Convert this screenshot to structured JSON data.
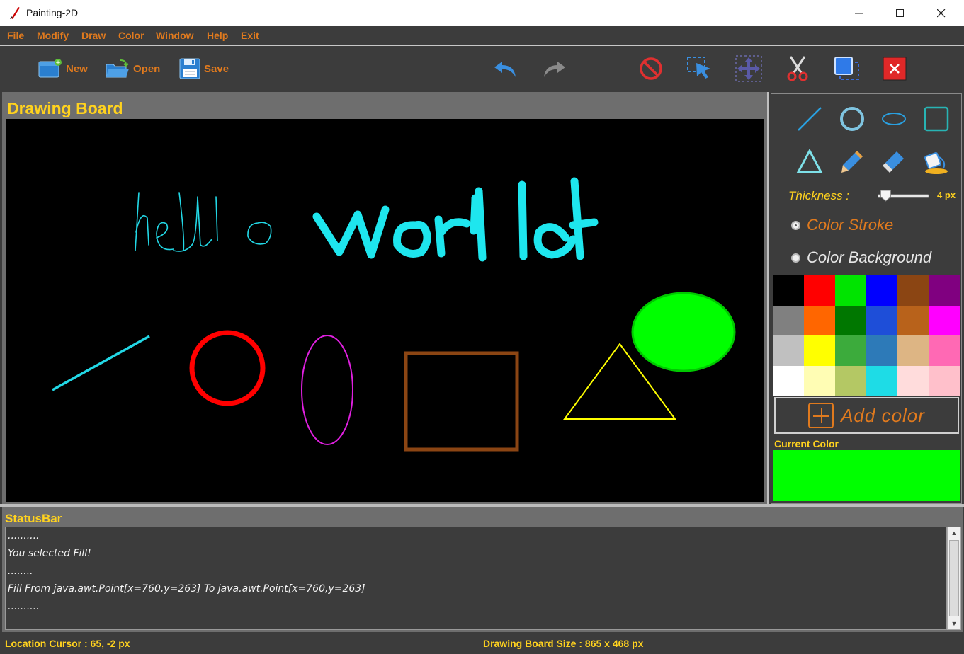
{
  "window": {
    "title": "Painting-2D",
    "minimize": "—",
    "maximize": "☐",
    "close": "✕"
  },
  "menu": [
    "File",
    "Modify",
    "Draw",
    "Color",
    "Window",
    "Help",
    "Exit"
  ],
  "toolbar": {
    "new_label": "New",
    "open_label": "Open",
    "save_label": "Save",
    "icons": [
      "new-file-icon",
      "open-folder-icon",
      "save-floppy-icon",
      "undo-icon",
      "redo-icon",
      "clear-icon",
      "select-icon",
      "move-icon",
      "cut-icon",
      "copy-icon",
      "delete-icon"
    ]
  },
  "board": {
    "title": "Drawing Board",
    "background": "#000000"
  },
  "tools": {
    "icons": [
      "line-tool-icon",
      "circle-tool-icon",
      "ellipse-tool-icon",
      "rectangle-tool-icon",
      "triangle-tool-icon",
      "pencil-tool-icon",
      "eraser-tool-icon",
      "fill-bucket-tool-icon"
    ],
    "thickness_label": "Thickness :",
    "thickness_value": "4 px",
    "thickness_level": 4,
    "color_stroke_label": "Color Stroke",
    "color_background_label": "Color Background",
    "palette": [
      "#000000",
      "#ff0000",
      "#00e400",
      "#0000ff",
      "#8b4513",
      "#800080",
      "#808080",
      "#ff6600",
      "#007700",
      "#1e4ed8",
      "#b8621b",
      "#ff00ff",
      "#c0c0c0",
      "#ffff00",
      "#3cab3c",
      "#2d7ab8",
      "#ddb584",
      "#ff69b4",
      "#ffffff",
      "#fffdb4",
      "#b4c864",
      "#1edce6",
      "#ffdcdc",
      "#ffc0cb"
    ],
    "add_color_label": "Add color",
    "current_color_label": "Current Color",
    "current_color": "#00ff00"
  },
  "status": {
    "title": "StatusBar",
    "lines": [
      "..........",
      "You selected Fill!",
      "........",
      "Fill From java.awt.Point[x=760,y=263] To java.awt.Point[x=760,y=263]",
      ".........."
    ]
  },
  "bottom": {
    "location": "Location Cursor : 65, -2 px",
    "board_size": "Drawing Board Size : 865 x 468 px"
  },
  "colors": {
    "accent": "#e07a1e",
    "label_yellow": "#ffd21e",
    "panel": "#3c3c3c"
  }
}
